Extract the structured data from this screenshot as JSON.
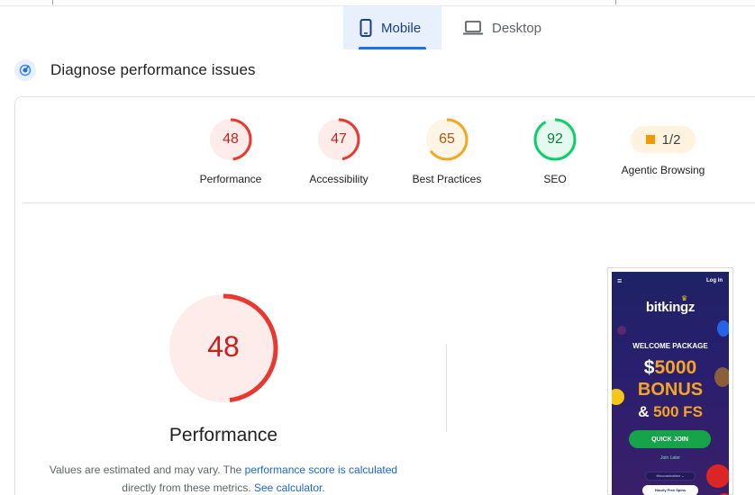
{
  "tabs": [
    {
      "label": "Mobile",
      "icon": "smartphone-icon",
      "active": true
    },
    {
      "label": "Desktop",
      "icon": "laptop-icon",
      "active": false
    }
  ],
  "section": {
    "title": "Diagnose performance issues",
    "icon": "diagnose-icon"
  },
  "scores": [
    {
      "label": "Performance",
      "value": "48",
      "fraction": 0.48,
      "color": "#e8382f",
      "bg": "#fdecea",
      "text_color": "#c5221f"
    },
    {
      "label": "Accessibility",
      "value": "47",
      "fraction": 0.47,
      "color": "#e8382f",
      "bg": "#fdecea",
      "text_color": "#c5221f"
    },
    {
      "label": "Best Practices",
      "value": "65",
      "fraction": 0.65,
      "color": "#f4a623",
      "bg": "#fef5e6",
      "text_color": "#b45309"
    },
    {
      "label": "SEO",
      "value": "92",
      "fraction": 0.92,
      "color": "#0cce6b",
      "bg": "#e6f9ee",
      "text_color": "#0b8043"
    }
  ],
  "agentic": {
    "label": "Agentic Browsing",
    "value": "1/2",
    "color": "#f29900"
  },
  "performance": {
    "score": "48",
    "fraction": 0.48,
    "title": "Performance",
    "note_prefix": "Values are estimated and may vary. The ",
    "note_link1": "performance score is calculated",
    "note_middle": "directly from these metrics. ",
    "note_link2": "See calculator",
    "note_suffix": "."
  },
  "screenshot": {
    "menu": "≡",
    "login": "Log in",
    "logo": "bitkingz",
    "welcome": "WELCOME PACKAGE",
    "dollar": "$",
    "amount": "5000",
    "bonus": "BONUS",
    "amp": "&",
    "fs": "500 FS",
    "button": "QUICK JOIN",
    "later": "Join Later",
    "pill1": "Woocasinokiez ⌄",
    "pill2": "Hourly Free Spins"
  }
}
